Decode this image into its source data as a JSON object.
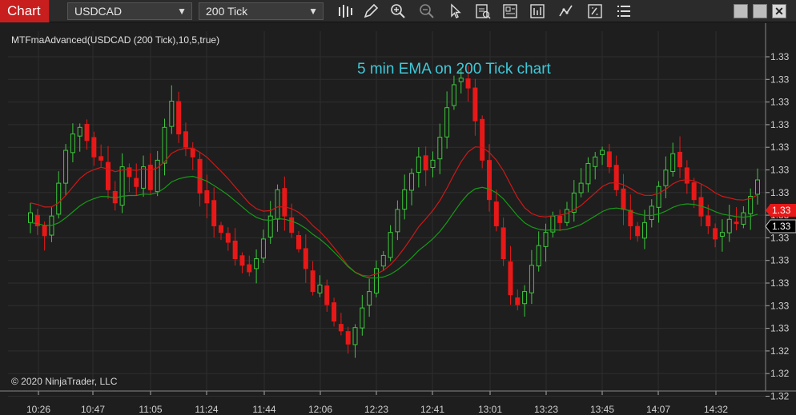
{
  "toolbar": {
    "chart_tab_label": "Chart",
    "instrument": "USDCAD",
    "interval": "200 Tick",
    "icons": [
      "bar-type-icon",
      "drawing-pencil-icon",
      "zoom-in-icon",
      "zoom-out-icon",
      "pointer-icon",
      "data-box-icon",
      "chart-style-icon",
      "strategy-icon",
      "indicators-icon",
      "properties-icon",
      "menu-icon"
    ],
    "window_buttons": [
      "minimize-icon",
      "maximize-icon",
      "close-icon"
    ],
    "close_label": "✕"
  },
  "chart": {
    "indicator_label": "MTFmaAdvanced(USDCAD (200 Tick),10,5,true)",
    "annotation": "5 min EMA on 200 Tick chart",
    "copyright": "© 2020 NinjaTrader, LLC",
    "x_labels": [
      "10:26",
      "10:47",
      "11:05",
      "11:24",
      "11:44",
      "12:06",
      "12:23",
      "12:41",
      "13:01",
      "13:23",
      "13:45",
      "14:07",
      "14:32"
    ],
    "y_labels": [
      "1.33",
      "1.33",
      "1.33",
      "1.33",
      "1.33",
      "1.33",
      "1.33",
      "1.33",
      "1.33",
      "1.33",
      "1.33",
      "1.33",
      "1.33",
      "1.32",
      "1.32",
      "1.32"
    ],
    "price_marker_red": "1.33",
    "price_marker_black": "1.33",
    "colors": {
      "up": "#3cc83c",
      "down": "#e81818",
      "ema_red": "#d01818",
      "ema_green": "#189a18",
      "grid": "#2e2e2e",
      "bg": "#1e1e1e"
    }
  },
  "chart_data": {
    "type": "candlestick",
    "candles_close": [
      132,
      128,
      125,
      131,
      141,
      151,
      156,
      158,
      154,
      149,
      148,
      139,
      135,
      146,
      143,
      140,
      146,
      139,
      148,
      158,
      166,
      156,
      152,
      149,
      138,
      135,
      128,
      126,
      123,
      118,
      116,
      114,
      118,
      124,
      131,
      139,
      131,
      126,
      121,
      115,
      108,
      110,
      104,
      99,
      96,
      92,
      97,
      103,
      108,
      115,
      119,
      126,
      133,
      139,
      144,
      149,
      145,
      148,
      155,
      164,
      171,
      173,
      170,
      160,
      148,
      136,
      128,
      118,
      107,
      104,
      108,
      116,
      122,
      126,
      131,
      129,
      133,
      138,
      141,
      147,
      149,
      151,
      146,
      139,
      133,
      128,
      125,
      129,
      134,
      140,
      145,
      150,
      146,
      141,
      136,
      131,
      128,
      124,
      126,
      130,
      129,
      132,
      137,
      142
    ]
  }
}
